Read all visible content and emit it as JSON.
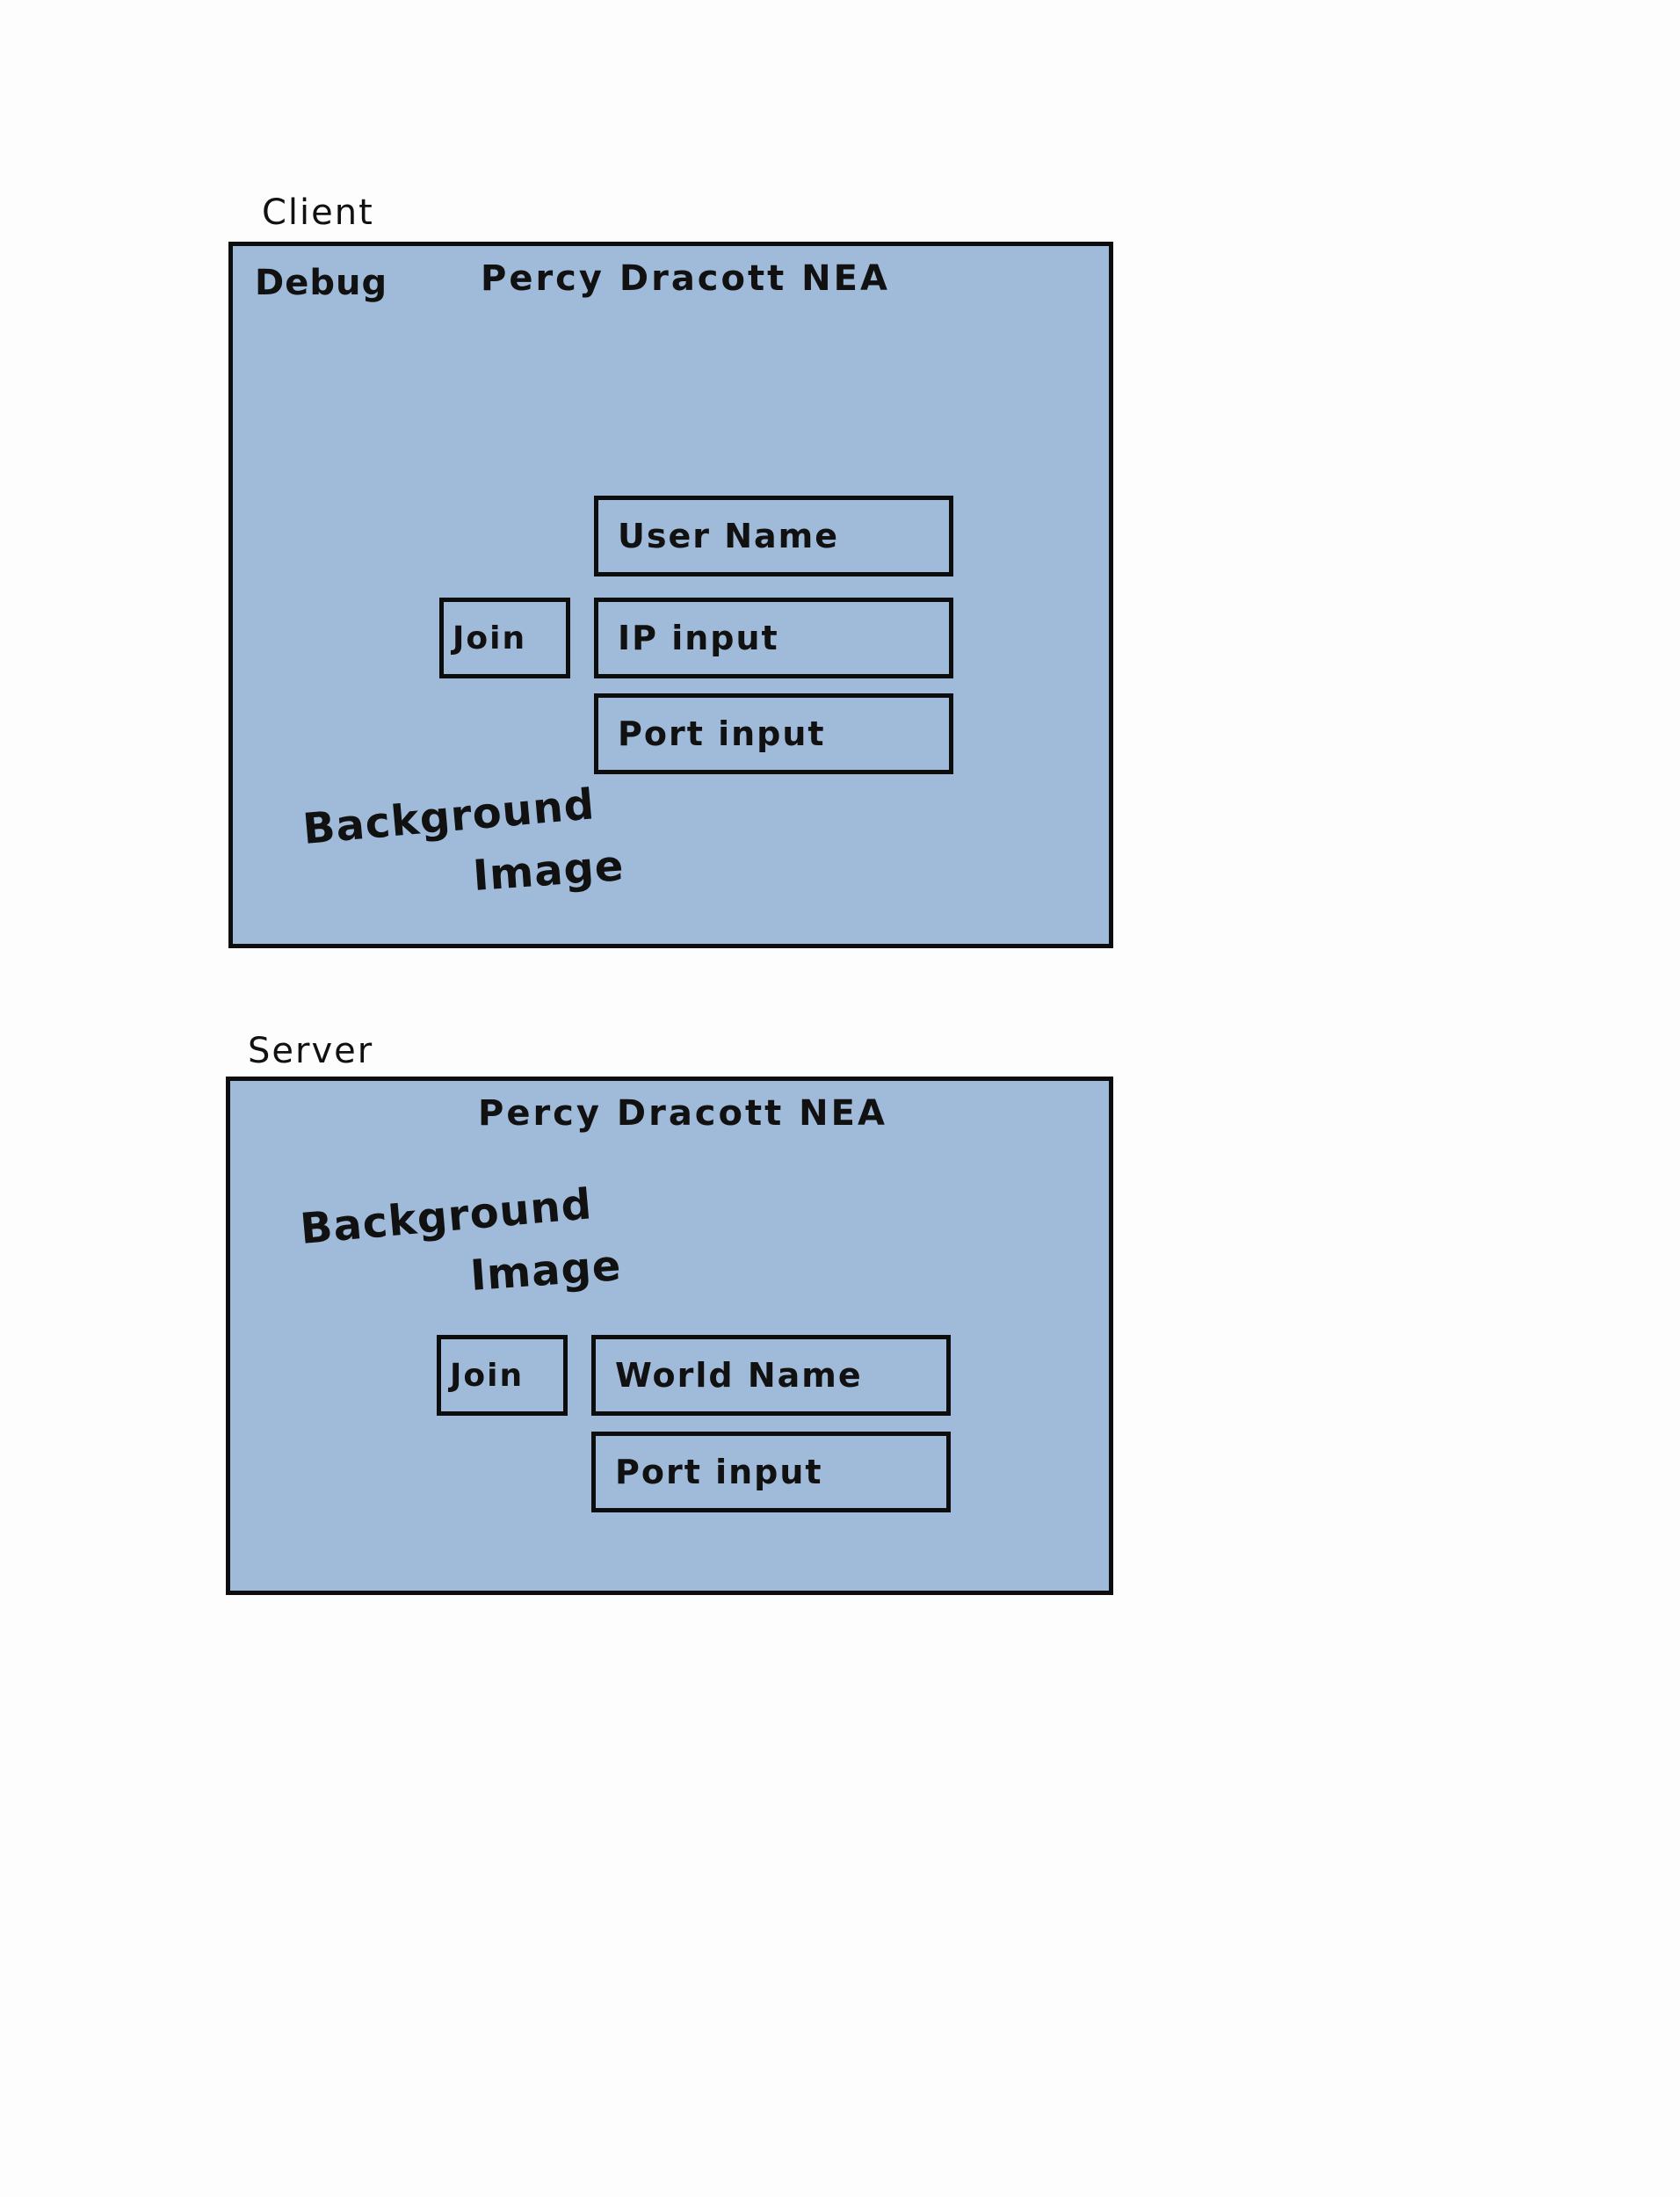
{
  "client": {
    "section_label": "Client",
    "debug_label": "Debug",
    "title": "Percy Dracott NEA",
    "username_field": "User Name",
    "join_button": "Join",
    "ip_field": "IP input",
    "port_field": "Port input",
    "background_line1": "Background",
    "background_line2": "Image"
  },
  "server": {
    "section_label": "Server",
    "title": "Percy Dracott NEA",
    "background_line1": "Background",
    "background_line2": "Image",
    "join_button": "Join",
    "world_name_field": "World Name",
    "port_field": "Port input"
  },
  "colors": {
    "panel_fill": "#a0bbd9",
    "border": "#0d0d0d",
    "page_background": "#fdfdfd"
  }
}
